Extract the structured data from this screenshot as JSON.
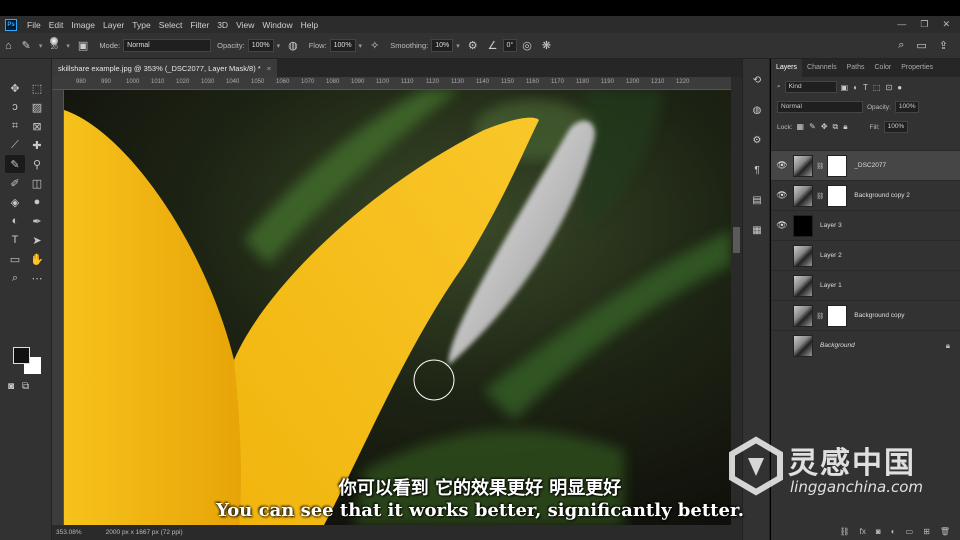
{
  "menubar": {
    "items": [
      "File",
      "Edit",
      "Image",
      "Layer",
      "Type",
      "Select",
      "Filter",
      "3D",
      "View",
      "Window",
      "Help"
    ]
  },
  "options": {
    "brush_size": "20",
    "mode_label": "Mode:",
    "mode_value": "Normal",
    "opacity_label": "Opacity:",
    "opacity_value": "100%",
    "flow_label": "Flow:",
    "flow_value": "100%",
    "smoothing_label": "Smoothing:",
    "smoothing_value": "10%",
    "angle_value": "0°"
  },
  "document": {
    "tab_title": "skillshare example.jpg @ 353% (_DSC2077, Layer Mask/8) *",
    "zoom": "353.08%",
    "dimensions": "2000 px x 1667 px (72 ppi)"
  },
  "ruler": {
    "ticks": [
      "980",
      "990",
      "1000",
      "1010",
      "1020",
      "1030",
      "1040",
      "1050",
      "1060",
      "1070",
      "1080",
      "1090",
      "1100",
      "1110",
      "1120",
      "1130",
      "1140",
      "1150",
      "1160",
      "1170",
      "1180",
      "1190",
      "1200",
      "1210",
      "1220"
    ]
  },
  "panel": {
    "tabs": [
      "Layers",
      "Channels",
      "Paths",
      "Color",
      "Properties"
    ],
    "filter_kind": "Kind",
    "blend_mode": "Normal",
    "opacity_label": "Opacity:",
    "opacity_value": "100%",
    "lock_label": "Lock:",
    "fill_label": "Fill:",
    "fill_value": "100%"
  },
  "layers": [
    {
      "name": "_DSC2077",
      "visible": true,
      "selected": true,
      "thumb": "photo",
      "mask": "white"
    },
    {
      "name": "Background copy 2",
      "visible": true,
      "selected": false,
      "thumb": "photo",
      "mask": "shape"
    },
    {
      "name": "Layer 3",
      "visible": true,
      "selected": false,
      "thumb": "black",
      "mask": null
    },
    {
      "name": "Layer 2",
      "visible": false,
      "selected": false,
      "thumb": "photo",
      "mask": null
    },
    {
      "name": "Layer 1",
      "visible": false,
      "selected": false,
      "thumb": "photo",
      "mask": null
    },
    {
      "name": "Background copy",
      "visible": false,
      "selected": false,
      "thumb": "photo",
      "mask": "shape"
    },
    {
      "name": "Background",
      "visible": false,
      "selected": false,
      "thumb": "photo",
      "mask": null,
      "locked": true
    }
  ],
  "subtitles": {
    "chinese": "你可以看到 它的效果更好 明显更好",
    "english": "You can see that it works better, significantly better."
  },
  "watermark": {
    "name": "灵感中国",
    "url": "lingganchina.com"
  },
  "colors": {
    "petal": "#f0b20a",
    "accent": "#31a8ff"
  }
}
